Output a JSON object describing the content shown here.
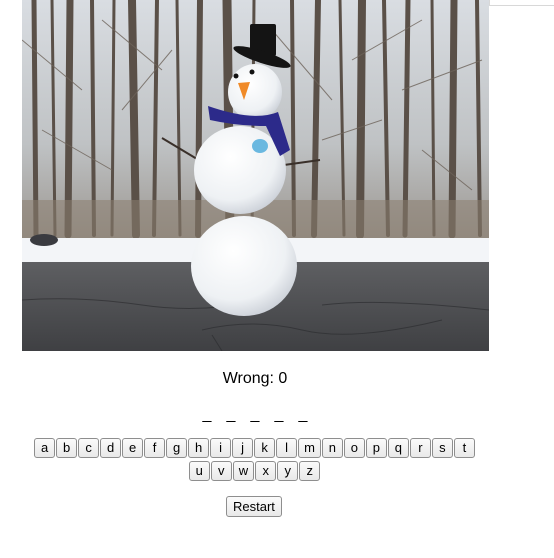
{
  "game": {
    "wrong_label": "Wrong: 0",
    "blanks": [
      "_",
      "_",
      "_",
      "_",
      "_"
    ],
    "restart_label": "Restart"
  },
  "keyboard": {
    "row1": [
      "a",
      "b",
      "c",
      "d",
      "e",
      "f",
      "g",
      "h",
      "i",
      "j",
      "k",
      "l",
      "m",
      "n",
      "o",
      "p",
      "q",
      "r",
      "s",
      "t"
    ],
    "row2": [
      "u",
      "v",
      "w",
      "x",
      "y",
      "z"
    ]
  },
  "image": {
    "subject": "snowman"
  }
}
